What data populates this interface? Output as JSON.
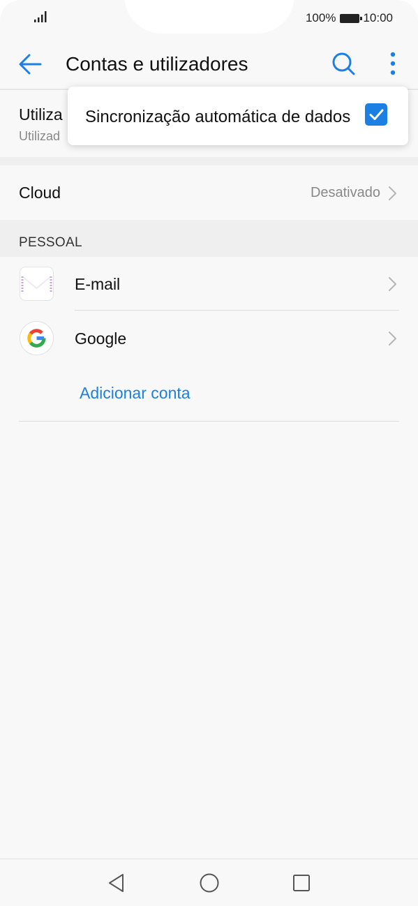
{
  "status_bar": {
    "battery_percent": "100%",
    "time": "10:00"
  },
  "app_bar": {
    "title": "Contas e utilizadores",
    "back_icon": "arrow-left-icon",
    "search_icon": "search-icon",
    "more_icon": "more-vert-icon"
  },
  "user_row": {
    "title": "Utiliza",
    "subtitle": "Utilizad"
  },
  "cloud_row": {
    "label": "Cloud",
    "value": "Desativado"
  },
  "section": {
    "header": "PESSOAL"
  },
  "accounts": [
    {
      "name": "E-mail",
      "icon": "email-envelope-icon"
    },
    {
      "name": "Google",
      "icon": "google-g-icon"
    }
  ],
  "add_account_label": "Adicionar conta",
  "popup_menu": {
    "label": "Sincronização automática de dados",
    "checked": true
  },
  "nav_bar": {
    "back": "nav-back-icon",
    "home": "nav-home-icon",
    "recents": "nav-recents-icon"
  },
  "colors": {
    "accent": "#1b7fe3",
    "background": "#f8f8f8"
  }
}
